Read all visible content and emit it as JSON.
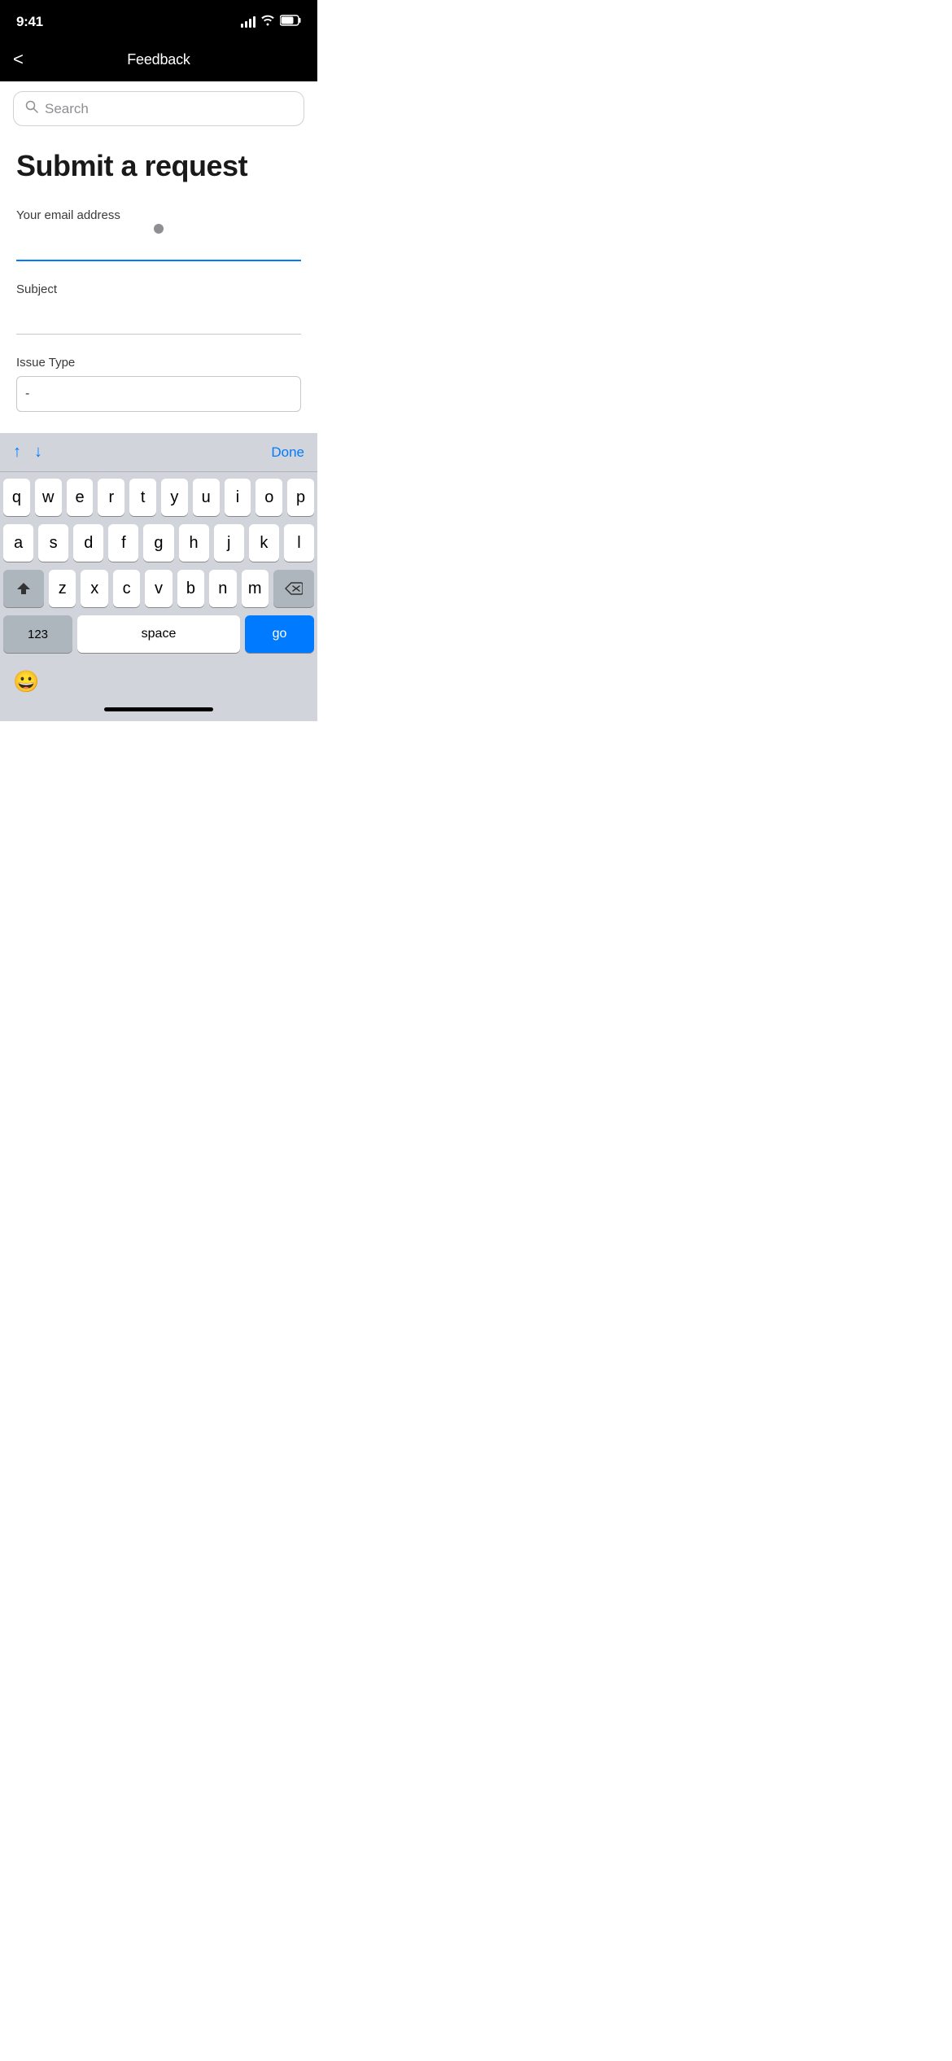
{
  "statusBar": {
    "time": "9:41",
    "signalBars": 4,
    "batteryLevel": 75
  },
  "navBar": {
    "title": "Feedback",
    "backLabel": "<"
  },
  "search": {
    "placeholder": "Search"
  },
  "form": {
    "pageTitle": "Submit a request",
    "emailLabel": "Your email address",
    "emailValue": "",
    "emailPlaceholder": "",
    "subjectLabel": "Subject",
    "subjectValue": "",
    "subjectPlaceholder": "",
    "issueTypeLabel": "Issue Type",
    "issueTypeValue": "-"
  },
  "keyboardToolbar": {
    "upLabel": "↑",
    "downLabel": "↓",
    "doneLabel": "Done"
  },
  "keyboard": {
    "rows": [
      [
        "q",
        "w",
        "e",
        "r",
        "t",
        "y",
        "u",
        "i",
        "o",
        "p"
      ],
      [
        "a",
        "s",
        "d",
        "f",
        "g",
        "h",
        "j",
        "k",
        "l"
      ],
      [
        "z",
        "x",
        "c",
        "v",
        "b",
        "n",
        "m"
      ]
    ],
    "spaceLabel": "space",
    "goLabel": "go",
    "numLabel": "123"
  },
  "emoji": {
    "symbol": "😀"
  }
}
